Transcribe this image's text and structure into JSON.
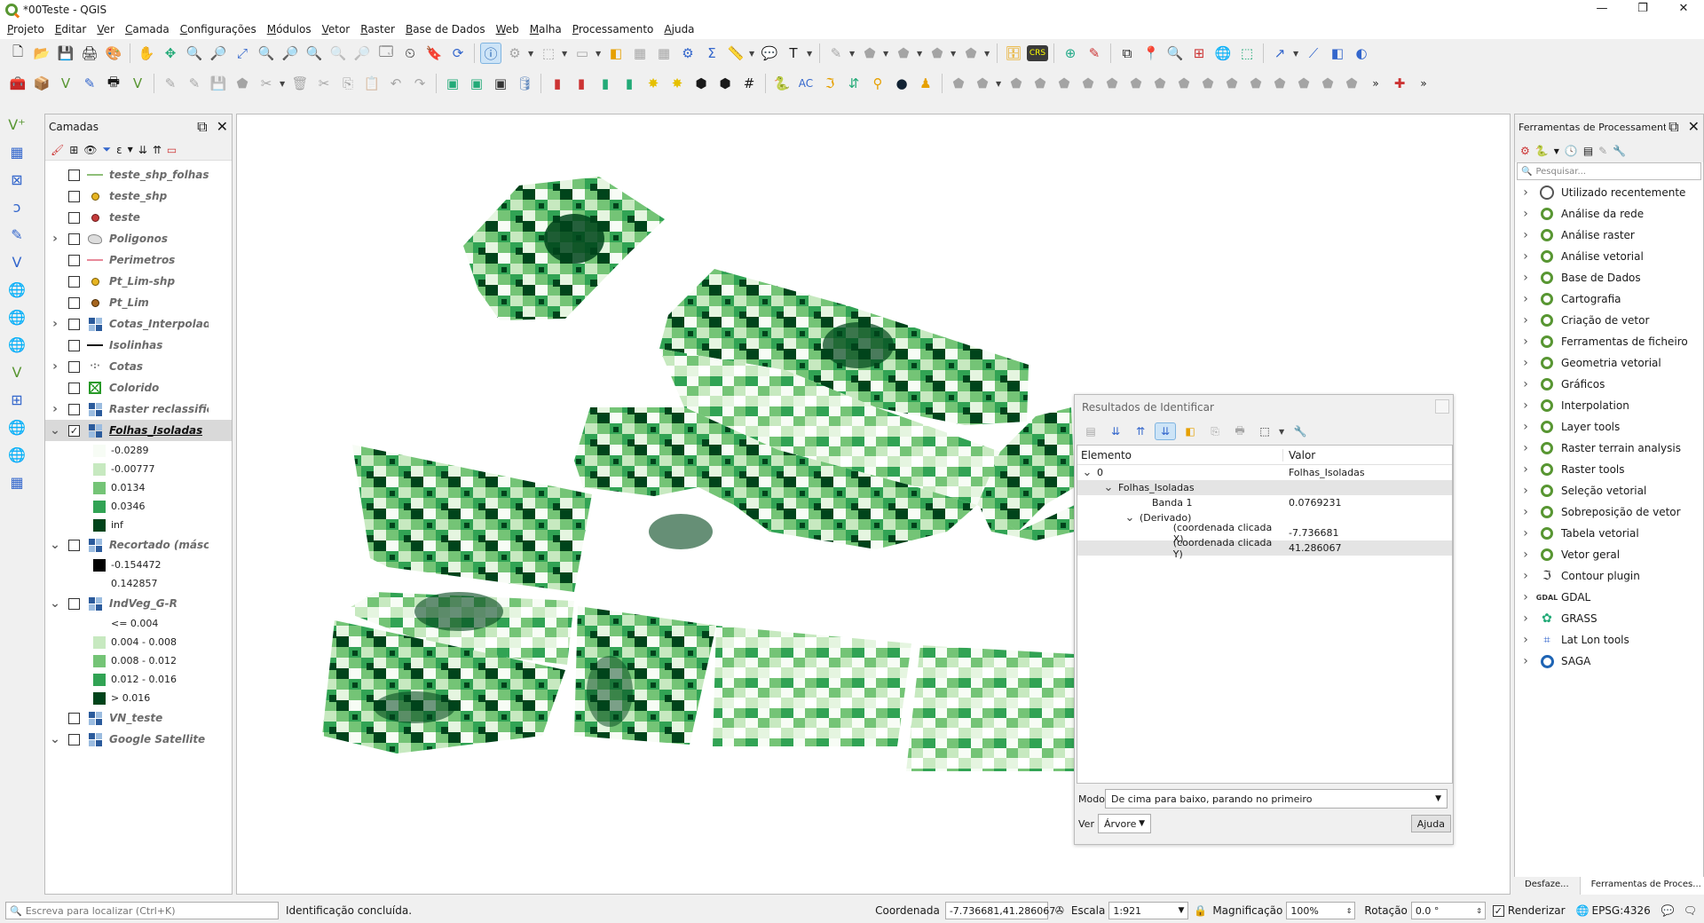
{
  "window": {
    "title": "*00Teste - QGIS",
    "minimize": "—",
    "maximize": "❐",
    "close": "✕"
  },
  "menu": [
    "Projeto",
    "Editar",
    "Ver",
    "Camada",
    "Configurações",
    "Módulos",
    "Vetor",
    "Raster",
    "Base de Dados",
    "Web",
    "Malha",
    "Processamento",
    "Ajuda"
  ],
  "layers_panel": {
    "title": "Camadas",
    "layers": [
      {
        "name": "teste_shp_folhas",
        "symbol": "line-green",
        "expandable": false,
        "checked": false
      },
      {
        "name": "teste_shp",
        "symbol": "point-orange",
        "expandable": false,
        "checked": false
      },
      {
        "name": "teste",
        "symbol": "point-red",
        "expandable": false,
        "checked": false
      },
      {
        "name": "Poligonos",
        "symbol": "polygon-grey",
        "expandable": true,
        "expanded": false,
        "checked": false
      },
      {
        "name": "Perimetros",
        "symbol": "line-pink",
        "expandable": false,
        "checked": false
      },
      {
        "name": "Pt_Lim-shp",
        "symbol": "point-orange",
        "expandable": false,
        "checked": false
      },
      {
        "name": "Pt_Lim",
        "symbol": "point-brown",
        "expandable": false,
        "checked": false
      },
      {
        "name": "Cotas_Interpolado",
        "symbol": "raster-icon",
        "expandable": true,
        "expanded": false,
        "checked": false
      },
      {
        "name": "Isolinhas",
        "symbol": "line-black",
        "expandable": false,
        "checked": false
      },
      {
        "name": "Cotas",
        "symbol": "points-grey",
        "expandable": true,
        "expanded": false,
        "checked": false
      },
      {
        "name": "Colorido",
        "symbol": "polygon-green-x",
        "expandable": false,
        "checked": false
      },
      {
        "name": "Raster reclassificado",
        "symbol": "raster-icon",
        "expandable": true,
        "expanded": false,
        "checked": false
      },
      {
        "name": "Folhas_Isoladas",
        "symbol": "raster-icon",
        "expandable": true,
        "expanded": true,
        "checked": true,
        "selected": true,
        "legend": [
          {
            "label": "-0.0289",
            "color": "#f7fcf5"
          },
          {
            "label": "-0.00777",
            "color": "#c7e9c0"
          },
          {
            "label": "0.0134",
            "color": "#74c476"
          },
          {
            "label": "0.0346",
            "color": "#31a354"
          },
          {
            "label": "inf",
            "color": "#00441b"
          }
        ]
      },
      {
        "name": "Recortado (máscara)",
        "symbol": "raster-icon",
        "expandable": true,
        "expanded": true,
        "checked": false,
        "legend": [
          {
            "label": "-0.154472",
            "color": "#000000"
          },
          {
            "label": "0.142857",
            "color": "#ffffff"
          }
        ]
      },
      {
        "name": "IndVeg_G-R",
        "symbol": "raster-icon",
        "expandable": true,
        "expanded": true,
        "checked": false,
        "legend": [
          {
            "label": "<= 0.004",
            "color": "#ffffff"
          },
          {
            "label": "0.004 - 0.008",
            "color": "#c7e9c0"
          },
          {
            "label": "0.008 - 0.012",
            "color": "#74c476"
          },
          {
            "label": "0.012 - 0.016",
            "color": "#31a354"
          },
          {
            "label": "> 0.016",
            "color": "#00441b"
          }
        ]
      },
      {
        "name": "VN_teste",
        "symbol": "raster-icon",
        "expandable": false,
        "checked": false
      },
      {
        "name": "Google Satellite",
        "symbol": "raster-icon",
        "expandable": true,
        "expanded": true,
        "checked": false
      }
    ]
  },
  "identify": {
    "title": "Resultados de Identificar",
    "col_element": "Elemento",
    "col_value": "Valor",
    "rows": [
      {
        "indent": 0,
        "arrow": "v",
        "element": "0",
        "value": "Folhas_Isoladas",
        "highlight": false
      },
      {
        "indent": 1,
        "arrow": "v",
        "element": "Folhas_Isoladas",
        "value": "",
        "highlight": true
      },
      {
        "indent": 2,
        "arrow": "",
        "element": "Banda 1",
        "value": "0.0769231",
        "highlight": false
      },
      {
        "indent": 2,
        "arrow": "v",
        "element": "(Derivado)",
        "value": "",
        "highlight": false
      },
      {
        "indent": 3,
        "arrow": "",
        "element": "(coordenada clicada X)",
        "value": "-7.736681",
        "highlight": false
      },
      {
        "indent": 3,
        "arrow": "",
        "element": "(coordenada clicada Y)",
        "value": "41.286067",
        "highlight": true
      }
    ],
    "mode_label": "Modo",
    "mode_value": "De cima para baixo, parando no primeiro",
    "view_label": "Ver",
    "view_value": "Árvore",
    "help_button": "Ajuda"
  },
  "processing": {
    "title": "Ferramentas de Processamento",
    "search_placeholder": "Pesquisar...",
    "items": [
      {
        "label": "Utilizado recentemente",
        "icon": "clock-icon"
      },
      {
        "label": "Análise da rede",
        "icon": "qgis-icon"
      },
      {
        "label": "Análise raster",
        "icon": "qgis-icon"
      },
      {
        "label": "Análise vetorial",
        "icon": "qgis-icon"
      },
      {
        "label": "Base de Dados",
        "icon": "qgis-icon"
      },
      {
        "label": "Cartografia",
        "icon": "qgis-icon"
      },
      {
        "label": "Criação de vetor",
        "icon": "qgis-icon"
      },
      {
        "label": "Ferramentas de ficheiro",
        "icon": "qgis-icon"
      },
      {
        "label": "Geometria vetorial",
        "icon": "qgis-icon"
      },
      {
        "label": "Gráficos",
        "icon": "qgis-icon"
      },
      {
        "label": "Interpolation",
        "icon": "qgis-icon"
      },
      {
        "label": "Layer tools",
        "icon": "qgis-icon"
      },
      {
        "label": "Raster terrain analysis",
        "icon": "qgis-icon"
      },
      {
        "label": "Raster tools",
        "icon": "qgis-icon"
      },
      {
        "label": "Seleção vetorial",
        "icon": "qgis-icon"
      },
      {
        "label": "Sobreposição de vetor",
        "icon": "qgis-icon"
      },
      {
        "label": "Tabela vetorial",
        "icon": "qgis-icon"
      },
      {
        "label": "Vetor geral",
        "icon": "qgis-icon"
      },
      {
        "label": "Contour plugin",
        "icon": "contour-icon"
      },
      {
        "label": "GDAL",
        "icon": "gdal-icon"
      },
      {
        "label": "GRASS",
        "icon": "grass-icon"
      },
      {
        "label": "Lat Lon tools",
        "icon": "latlon-icon"
      },
      {
        "label": "SAGA",
        "icon": "saga-icon"
      }
    ],
    "tabs": [
      "Desfaze...",
      "Ferramentas de Proces..."
    ]
  },
  "statusbar": {
    "locator_placeholder": "Escreva para localizar (Ctrl+K)",
    "message": "Identificação concluída.",
    "coord_label": "Coordenada",
    "coord_value": "-7.736681,41.286067",
    "scale_label": "Escala",
    "scale_value": "1:921",
    "magnifier_label": "Magnificação",
    "magnifier_value": "100%",
    "rotation_label": "Rotação",
    "rotation_value": "0.0 °",
    "render_label": "Renderizar",
    "crs": "EPSG:4326"
  },
  "colors": {
    "ramp": [
      "#f7fcf5",
      "#c7e9c0",
      "#74c476",
      "#31a354",
      "#00441b"
    ],
    "accent": "#589632"
  }
}
